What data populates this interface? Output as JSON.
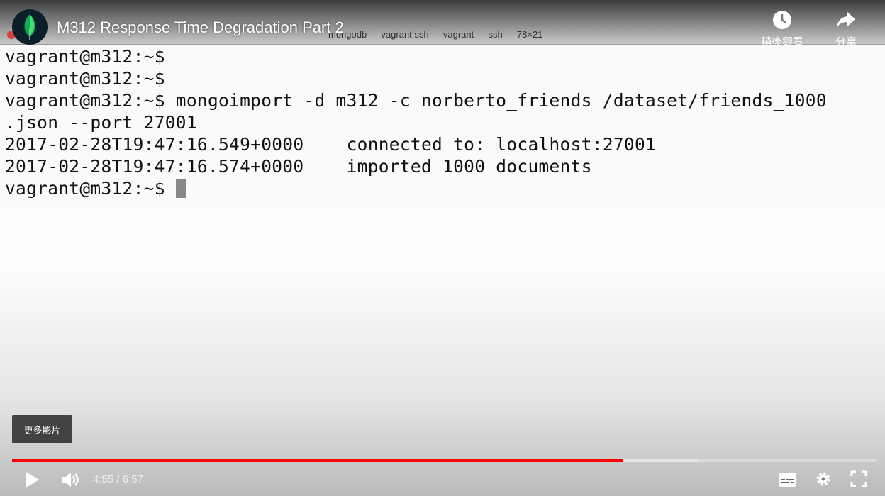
{
  "video": {
    "title": "M312 Response Time Degradation Part 2",
    "terminal_window_title": "mongodb — vagrant ssh — vagrant — ssh — 78×21",
    "terminal_lines": [
      "vagrant@m312:~$",
      "vagrant@m312:~$",
      "vagrant@m312:~$ mongoimport -d m312 -c norberto_friends /dataset/friends_1000",
      ".json --port 27001",
      "2017-02-28T19:47:16.549+0000    connected to: localhost:27001",
      "2017-02-28T19:47:16.574+0000    imported 1000 documents",
      "vagrant@m312:~$ "
    ]
  },
  "top_actions": {
    "watch_later": "稍後觀看",
    "share": "分享"
  },
  "more_videos": "更多影片",
  "player": {
    "current_time": "4:55",
    "duration": "6:57",
    "time_display": "4:55 / 6:57",
    "played_fraction": 0.707,
    "buffered_fraction": 0.794,
    "progress_color": "#ff0000"
  }
}
